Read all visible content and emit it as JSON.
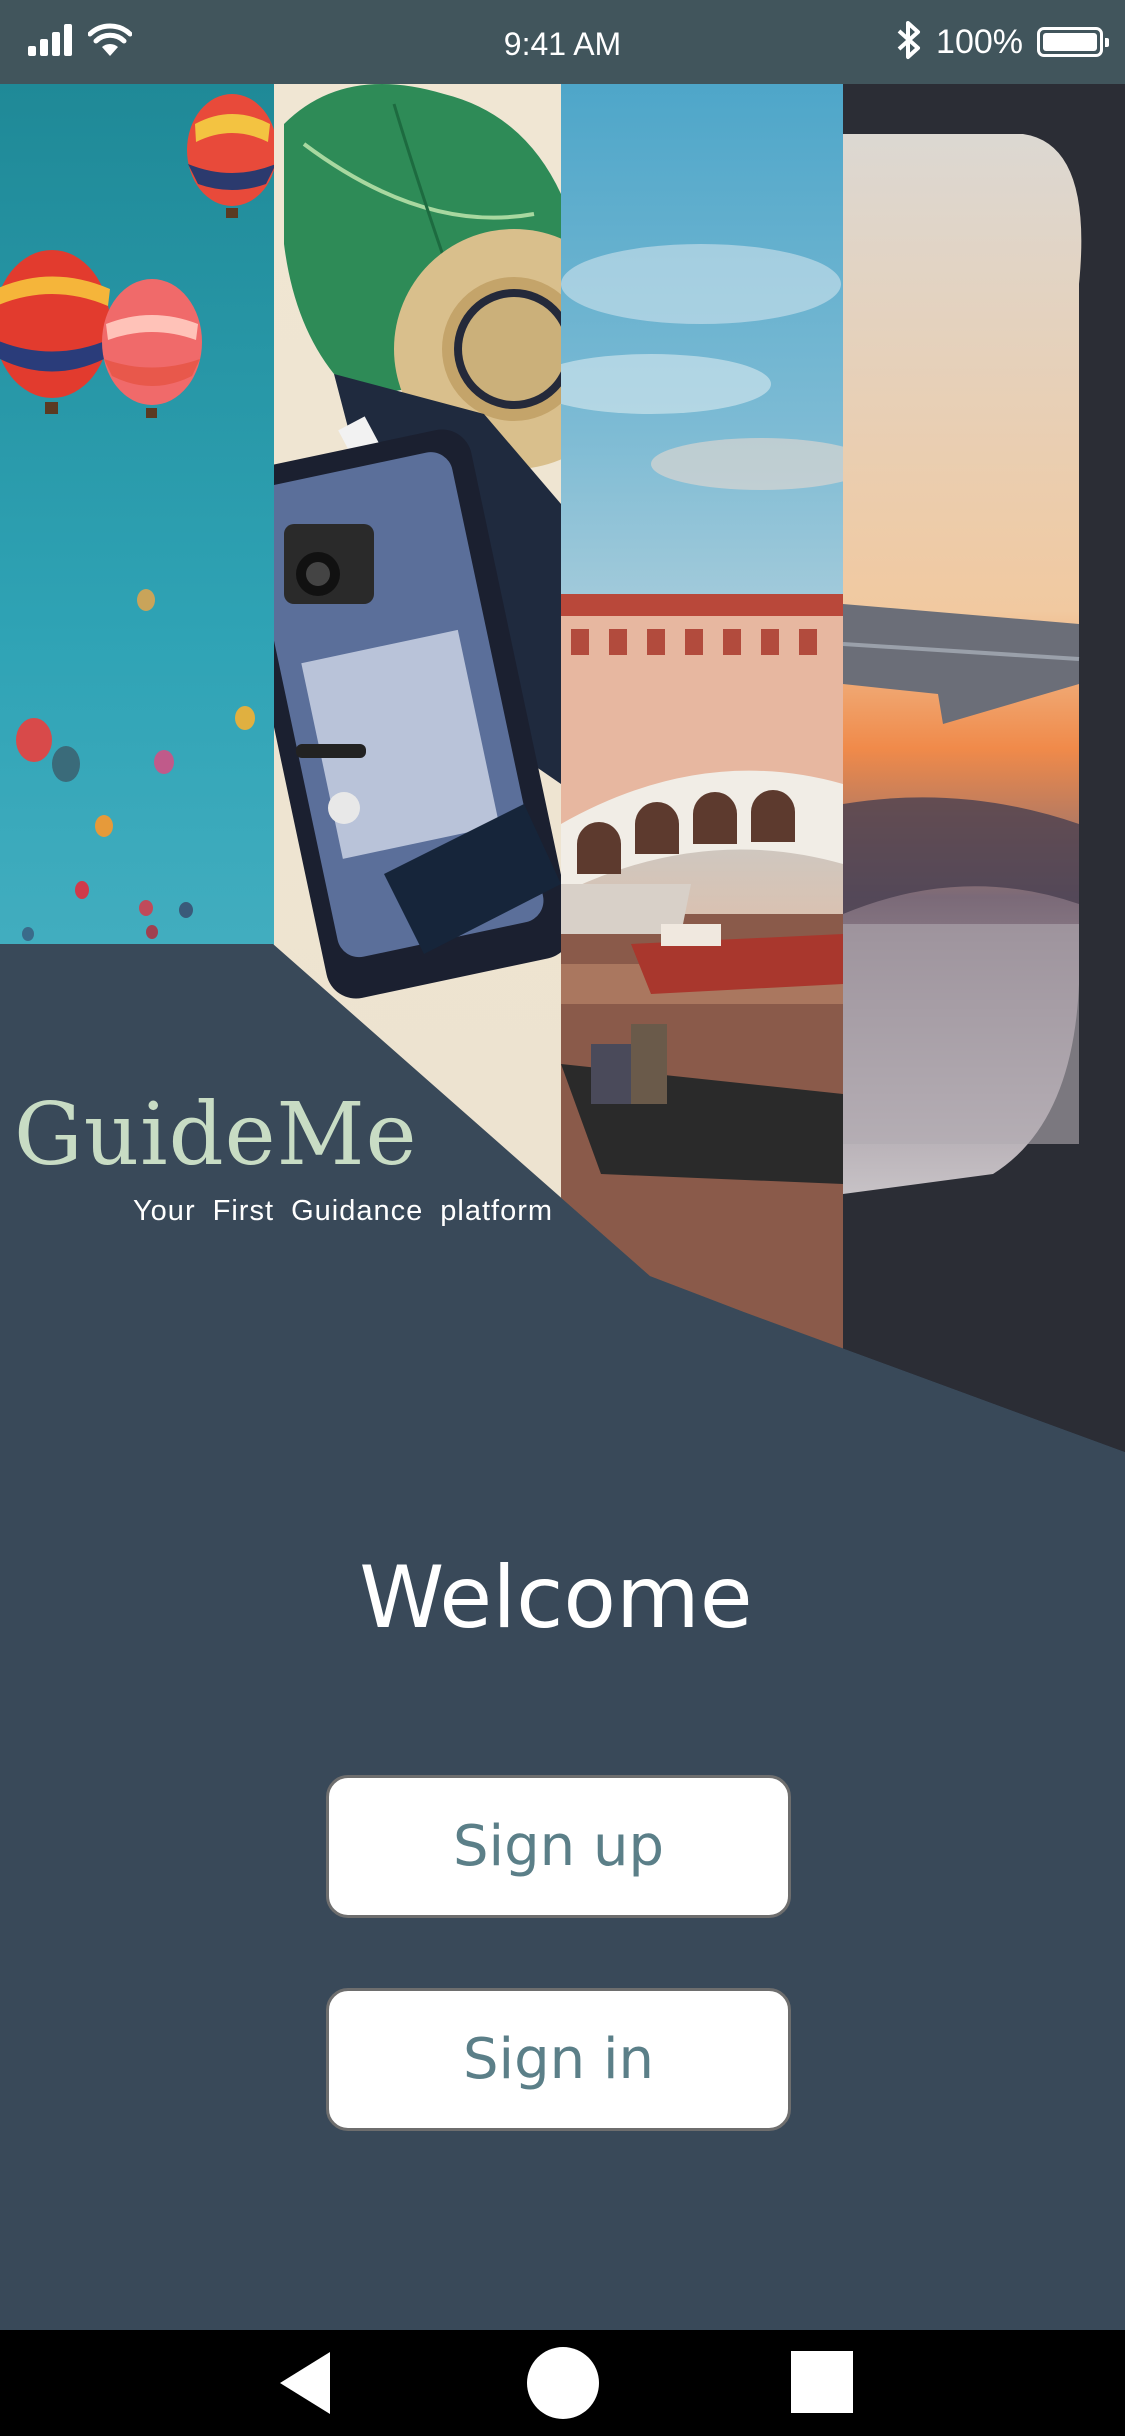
{
  "status_bar": {
    "time": "9:41 AM",
    "battery_percent": "100%",
    "battery_level": 1.0,
    "icons": [
      "signal-icon",
      "wifi-icon",
      "bluetooth-icon",
      "battery-icon"
    ]
  },
  "brand": {
    "name": "GuideMe",
    "tagline": "Your First Guidance platform",
    "title_color": "#c8dcc4"
  },
  "welcome": {
    "title": "Welcome"
  },
  "buttons": {
    "sign_up": "Sign up",
    "sign_in": "Sign in",
    "label_color": "#5b7f88"
  },
  "hero_images": [
    "hot-air-balloons-photo",
    "packed-suitcase-photo",
    "venice-rialto-bridge-photo",
    "airplane-window-sunset-photo"
  ],
  "nav_bar": {
    "icons": [
      "back-icon",
      "home-icon",
      "recents-icon"
    ]
  },
  "colors": {
    "background": "#394959",
    "status_bar": "#41555c"
  }
}
